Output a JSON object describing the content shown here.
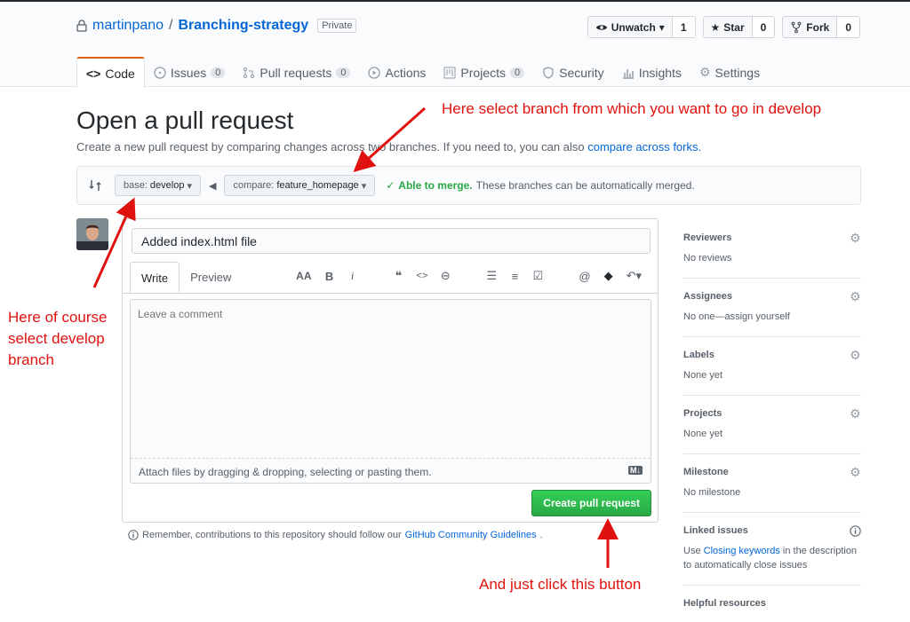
{
  "repo": {
    "owner": "martinpano",
    "slash": "/",
    "name": "Branching-strategy",
    "visibility": "Private"
  },
  "actions": {
    "watch": {
      "label": "Unwatch",
      "count": "1"
    },
    "star": {
      "label": "Star",
      "count": "0"
    },
    "fork": {
      "label": "Fork",
      "count": "0"
    }
  },
  "tabs": [
    {
      "label": "Code",
      "counter": ""
    },
    {
      "label": "Issues",
      "counter": "0"
    },
    {
      "label": "Pull requests",
      "counter": "0"
    },
    {
      "label": "Actions",
      "counter": ""
    },
    {
      "label": "Projects",
      "counter": "0"
    },
    {
      "label": "Security",
      "counter": ""
    },
    {
      "label": "Insights",
      "counter": ""
    },
    {
      "label": "Settings",
      "counter": ""
    }
  ],
  "page": {
    "title": "Open a pull request",
    "subtitle": "Create a new pull request by comparing changes across two branches. If you need to, you can also",
    "subtitle_link": "compare across forks."
  },
  "range": {
    "base_label": "base:",
    "base_value": "develop",
    "compare_label": "compare:",
    "compare_value": "feature_homepage",
    "merge_ok": "Able to merge.",
    "merge_text": "These branches can be automatically merged."
  },
  "form": {
    "title_value": "Added index.html file",
    "write_tab": "Write",
    "preview_tab": "Preview",
    "comment_placeholder": "Leave a comment",
    "attach_text": "Attach files by dragging & dropping, selecting or pasting them.",
    "md_badge": "M↓",
    "submit": "Create pull request"
  },
  "toolbar": [
    "AA",
    "B",
    "i",
    "❝",
    "<>",
    "⊖",
    "☰",
    "≡",
    "☑",
    "@",
    "◆",
    "↶▾"
  ],
  "reminder": {
    "text": "Remember, contributions to this repository should follow our",
    "link": "GitHub Community Guidelines",
    "end": "."
  },
  "sidebar": [
    {
      "heading": "Reviewers",
      "value": "No reviews"
    },
    {
      "heading": "Assignees",
      "value": "No one—assign yourself"
    },
    {
      "heading": "Labels",
      "value": "None yet"
    },
    {
      "heading": "Projects",
      "value": "None yet"
    },
    {
      "heading": "Milestone",
      "value": "No milestone"
    },
    {
      "heading": "Linked issues",
      "value_pre": "Use",
      "value_link": "Closing keywords",
      "value_post": "in the description to automatically close issues"
    },
    {
      "heading": "Helpful resources"
    }
  ],
  "annotations": {
    "top": "Here select branch from which you want to go in develop",
    "left_1": "Here of course",
    "left_2": "select develop",
    "left_3": "branch",
    "bottom": "And just click this button"
  },
  "colors": {
    "accent_tab": "#e36209",
    "link": "#0366d6",
    "success": "#28a745",
    "annotation": "#e0120f"
  }
}
